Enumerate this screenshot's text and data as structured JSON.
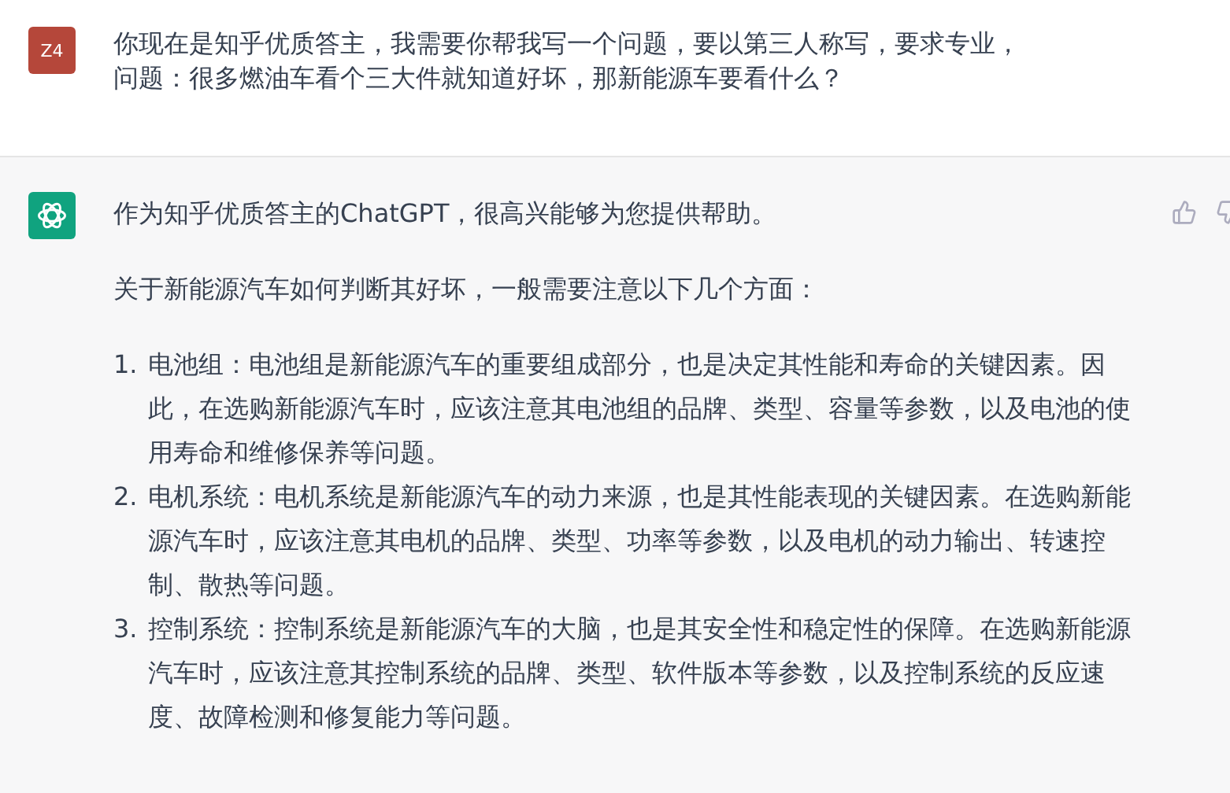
{
  "messages": [
    {
      "kind": "user",
      "avatar": "Z4",
      "paragraphs": [
        "你现在是知乎优质答主，我需要你帮我写一个问题，要以第三人称写，要求专业，",
        "问题：很多燃油车看个三大件就知道好坏，那新能源车要看什么？"
      ]
    },
    {
      "kind": "assistant",
      "paragraphs": [
        "作为知乎优质答主的ChatGPT，很高兴能够为您提供帮助。",
        "关于新能源汽车如何判断其好坏，一般需要注意以下几个方面："
      ],
      "list": [
        {
          "number": "1.",
          "text": "电池组：电池组是新能源汽车的重要组成部分，也是决定其性能和寿命的关键因素。因此，在选购新能源汽车时，应该注意其电池组的品牌、类型、容量等参数，以及电池的使用寿命和维修保养等问题。"
        },
        {
          "number": "2.",
          "text": "电机系统：电机系统是新能源汽车的动力来源，也是其性能表现的关键因素。在选购新能源汽车时，应该注意其电机的品牌、类型、功率等参数，以及电机的动力输出、转速控制、散热等问题。"
        },
        {
          "number": "3.",
          "text": "控制系统：控制系统是新能源汽车的大脑，也是其安全性和稳定性的保障。在选购新能源汽车时，应该注意其控制系统的品牌、类型、软件版本等参数，以及控制系统的反应速度、故障检测和修复能力等问题。"
        }
      ]
    }
  ]
}
